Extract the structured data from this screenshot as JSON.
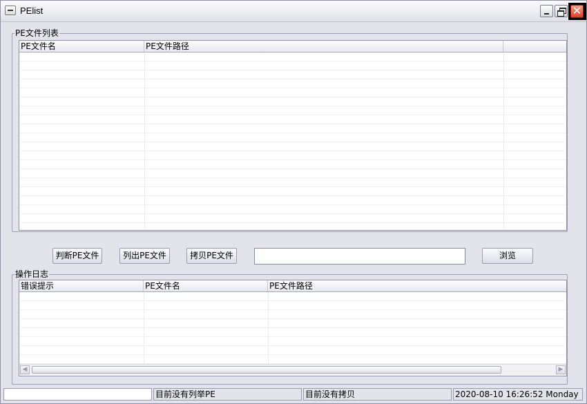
{
  "window": {
    "title": "PElist"
  },
  "pe_group": {
    "legend": "PE文件列表",
    "columns": [
      "PE文件名",
      "PE文件路径"
    ]
  },
  "toolbar": {
    "check_label": "判断PE文件",
    "list_label": "列出PE文件",
    "copy_label": "拷贝PE文件",
    "path_value": "",
    "browse_label": "浏览"
  },
  "log_group": {
    "legend": "操作日志",
    "columns": [
      "错误提示",
      "PE文件名",
      "PE文件路径"
    ]
  },
  "statusbar": {
    "pane0": "",
    "pane1": "目前没有列举PE",
    "pane2": "目前没有拷贝",
    "datetime": "2020-08-10 16:26:52 Monday"
  },
  "icons": {
    "system_menu": "window-menu-icon",
    "minimize": "minimize-icon",
    "restore": "restore-icon",
    "close": "close-icon"
  }
}
